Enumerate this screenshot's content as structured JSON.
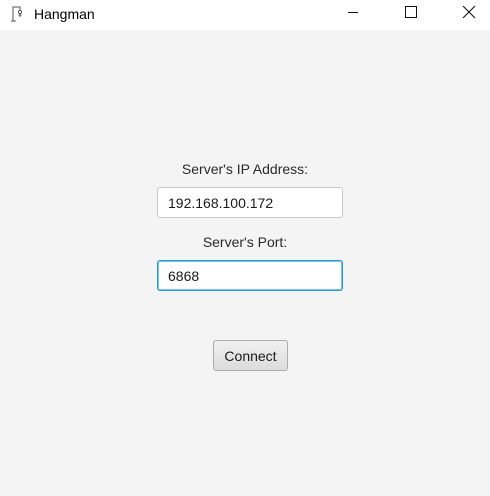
{
  "window": {
    "title": "Hangman",
    "icon": "app-icon",
    "controls": {
      "minimize_icon": "minimize-icon",
      "maximize_icon": "maximize-icon",
      "close_icon": "close-icon"
    }
  },
  "form": {
    "ip_label": "Server's IP Address:",
    "ip_value": "192.168.100.172",
    "port_label": "Server's Port:",
    "port_value": "6868",
    "connect_label": "Connect"
  },
  "colors": {
    "background": "#f4f4f4",
    "focus_border": "#1e9ae0"
  }
}
